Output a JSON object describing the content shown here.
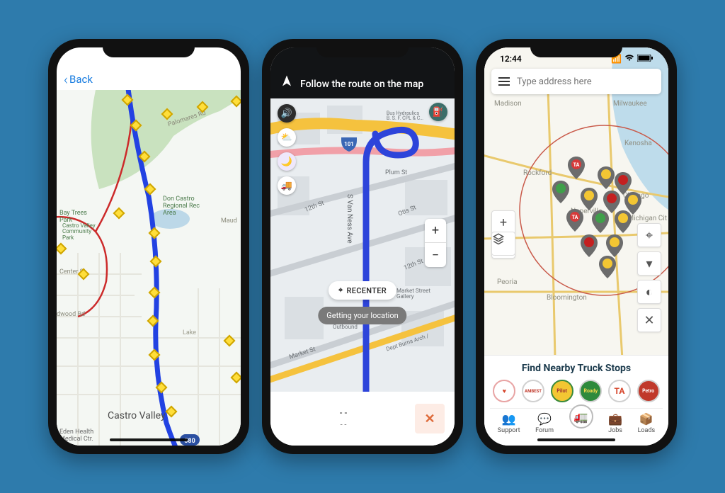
{
  "phone1": {
    "back_label": "Back",
    "labels": {
      "palomares": "Palomares Rd",
      "maud": "Maud",
      "center": "Center St",
      "dwood": "dwood Rd",
      "lake": "Lake",
      "bay_trees": "Bay Trees\nPark",
      "don_castro": "Don Castro\nRegional Rec\nArea",
      "wilbeam": "Castro Valley\nCommunity\nPark",
      "castro_valley": "Castro Valley",
      "eden": "Eden Health\nMedical Ctr."
    }
  },
  "phone2": {
    "header": "Follow the route on the map",
    "recenter": "RECENTER",
    "toast": "Getting your location",
    "zoom_in": "+",
    "zoom_out": "−",
    "dash_a": "- -",
    "dash_b": "- -",
    "close": "✕",
    "labels": {
      "plum": "Plum St",
      "twelfth": "12th St",
      "otis": "Otis St",
      "vaness": "S Van Ness Ave",
      "market": "Market St",
      "market_gallery": "Market Street\nGallery",
      "vaness_station": "Van Ness\nStation\nOutbound",
      "dept": "Dept Burns Arch /",
      "bus_hydraulics": "Bus Hydraulics\nB. S. F. CPL & C…"
    }
  },
  "phone3": {
    "time": "12:44",
    "search_placeholder": "Type address here",
    "footer_title": "Find Nearby Truck Stops",
    "zoom_in": "+",
    "zoom_out": "−",
    "brands": [
      "Loves",
      "AMBEST",
      "Pilot",
      "Roady",
      "TA",
      "Petro"
    ],
    "nav": [
      "Support",
      "Forum",
      "",
      "Jobs",
      "Loads"
    ],
    "cities": {
      "madison": "Madison",
      "milwaukee": "Milwaukee",
      "rockford": "Rockford",
      "kenosha": "Kenosha",
      "naperville": "Naperville",
      "chicago": "Chicago",
      "michigan": "Michigan Cit",
      "peoria": "Peoria",
      "bloomington": "Bloomington"
    }
  }
}
